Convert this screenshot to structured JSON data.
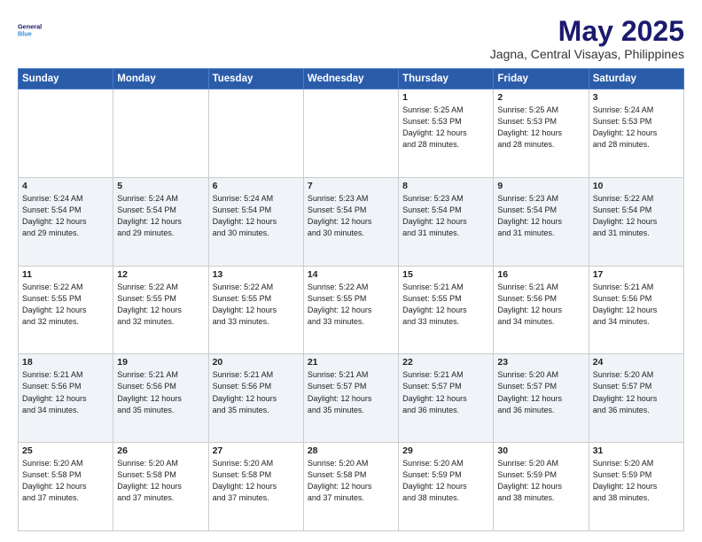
{
  "header": {
    "logo_line1": "General",
    "logo_line2": "Blue",
    "title": "May 2025",
    "subtitle": "Jagna, Central Visayas, Philippines"
  },
  "calendar": {
    "days_of_week": [
      "Sunday",
      "Monday",
      "Tuesday",
      "Wednesday",
      "Thursday",
      "Friday",
      "Saturday"
    ],
    "weeks": [
      [
        {
          "day": "",
          "content": ""
        },
        {
          "day": "",
          "content": ""
        },
        {
          "day": "",
          "content": ""
        },
        {
          "day": "",
          "content": ""
        },
        {
          "day": "1",
          "content": "Sunrise: 5:25 AM\nSunset: 5:53 PM\nDaylight: 12 hours\nand 28 minutes."
        },
        {
          "day": "2",
          "content": "Sunrise: 5:25 AM\nSunset: 5:53 PM\nDaylight: 12 hours\nand 28 minutes."
        },
        {
          "day": "3",
          "content": "Sunrise: 5:24 AM\nSunset: 5:53 PM\nDaylight: 12 hours\nand 28 minutes."
        }
      ],
      [
        {
          "day": "4",
          "content": "Sunrise: 5:24 AM\nSunset: 5:54 PM\nDaylight: 12 hours\nand 29 minutes."
        },
        {
          "day": "5",
          "content": "Sunrise: 5:24 AM\nSunset: 5:54 PM\nDaylight: 12 hours\nand 29 minutes."
        },
        {
          "day": "6",
          "content": "Sunrise: 5:24 AM\nSunset: 5:54 PM\nDaylight: 12 hours\nand 30 minutes."
        },
        {
          "day": "7",
          "content": "Sunrise: 5:23 AM\nSunset: 5:54 PM\nDaylight: 12 hours\nand 30 minutes."
        },
        {
          "day": "8",
          "content": "Sunrise: 5:23 AM\nSunset: 5:54 PM\nDaylight: 12 hours\nand 31 minutes."
        },
        {
          "day": "9",
          "content": "Sunrise: 5:23 AM\nSunset: 5:54 PM\nDaylight: 12 hours\nand 31 minutes."
        },
        {
          "day": "10",
          "content": "Sunrise: 5:22 AM\nSunset: 5:54 PM\nDaylight: 12 hours\nand 31 minutes."
        }
      ],
      [
        {
          "day": "11",
          "content": "Sunrise: 5:22 AM\nSunset: 5:55 PM\nDaylight: 12 hours\nand 32 minutes."
        },
        {
          "day": "12",
          "content": "Sunrise: 5:22 AM\nSunset: 5:55 PM\nDaylight: 12 hours\nand 32 minutes."
        },
        {
          "day": "13",
          "content": "Sunrise: 5:22 AM\nSunset: 5:55 PM\nDaylight: 12 hours\nand 33 minutes."
        },
        {
          "day": "14",
          "content": "Sunrise: 5:22 AM\nSunset: 5:55 PM\nDaylight: 12 hours\nand 33 minutes."
        },
        {
          "day": "15",
          "content": "Sunrise: 5:21 AM\nSunset: 5:55 PM\nDaylight: 12 hours\nand 33 minutes."
        },
        {
          "day": "16",
          "content": "Sunrise: 5:21 AM\nSunset: 5:56 PM\nDaylight: 12 hours\nand 34 minutes."
        },
        {
          "day": "17",
          "content": "Sunrise: 5:21 AM\nSunset: 5:56 PM\nDaylight: 12 hours\nand 34 minutes."
        }
      ],
      [
        {
          "day": "18",
          "content": "Sunrise: 5:21 AM\nSunset: 5:56 PM\nDaylight: 12 hours\nand 34 minutes."
        },
        {
          "day": "19",
          "content": "Sunrise: 5:21 AM\nSunset: 5:56 PM\nDaylight: 12 hours\nand 35 minutes."
        },
        {
          "day": "20",
          "content": "Sunrise: 5:21 AM\nSunset: 5:56 PM\nDaylight: 12 hours\nand 35 minutes."
        },
        {
          "day": "21",
          "content": "Sunrise: 5:21 AM\nSunset: 5:57 PM\nDaylight: 12 hours\nand 35 minutes."
        },
        {
          "day": "22",
          "content": "Sunrise: 5:21 AM\nSunset: 5:57 PM\nDaylight: 12 hours\nand 36 minutes."
        },
        {
          "day": "23",
          "content": "Sunrise: 5:20 AM\nSunset: 5:57 PM\nDaylight: 12 hours\nand 36 minutes."
        },
        {
          "day": "24",
          "content": "Sunrise: 5:20 AM\nSunset: 5:57 PM\nDaylight: 12 hours\nand 36 minutes."
        }
      ],
      [
        {
          "day": "25",
          "content": "Sunrise: 5:20 AM\nSunset: 5:58 PM\nDaylight: 12 hours\nand 37 minutes."
        },
        {
          "day": "26",
          "content": "Sunrise: 5:20 AM\nSunset: 5:58 PM\nDaylight: 12 hours\nand 37 minutes."
        },
        {
          "day": "27",
          "content": "Sunrise: 5:20 AM\nSunset: 5:58 PM\nDaylight: 12 hours\nand 37 minutes."
        },
        {
          "day": "28",
          "content": "Sunrise: 5:20 AM\nSunset: 5:58 PM\nDaylight: 12 hours\nand 37 minutes."
        },
        {
          "day": "29",
          "content": "Sunrise: 5:20 AM\nSunset: 5:59 PM\nDaylight: 12 hours\nand 38 minutes."
        },
        {
          "day": "30",
          "content": "Sunrise: 5:20 AM\nSunset: 5:59 PM\nDaylight: 12 hours\nand 38 minutes."
        },
        {
          "day": "31",
          "content": "Sunrise: 5:20 AM\nSunset: 5:59 PM\nDaylight: 12 hours\nand 38 minutes."
        }
      ]
    ]
  }
}
